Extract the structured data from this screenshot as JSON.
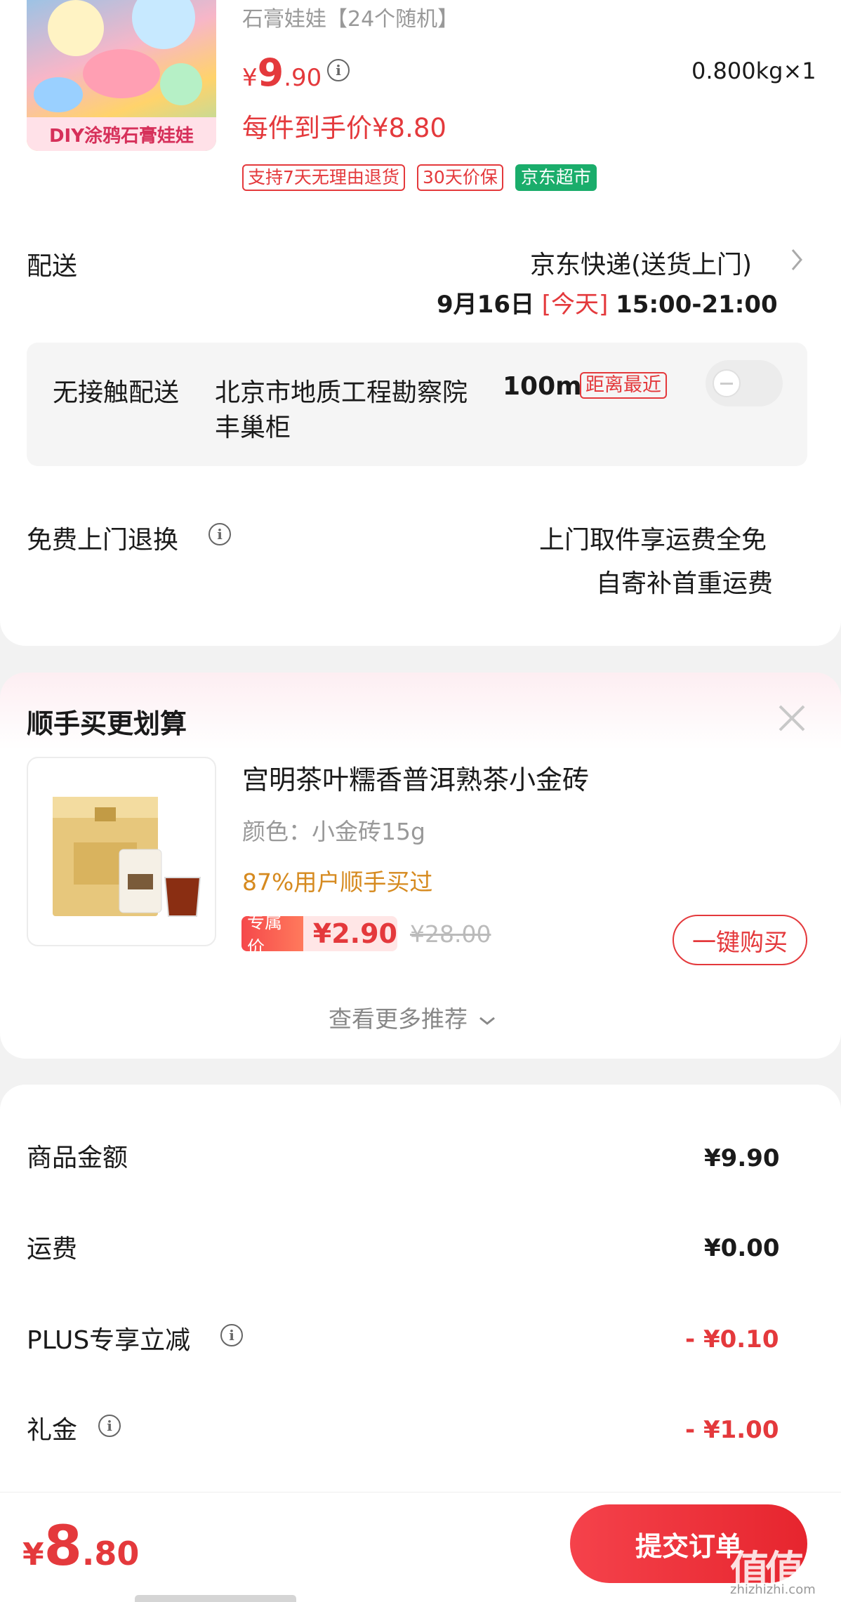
{
  "product": {
    "title_tail": "石膏娃娃【24个随机】",
    "image_banner": "DIY涂鸦石膏娃娃",
    "price_symbol": "¥",
    "price_int": "9",
    "price_dec": ".90",
    "weight_qty": "0.800kg×1",
    "final_price": "每件到手价¥8.80",
    "tags": [
      "支持7天无理由退货",
      "30天价保"
    ],
    "store_tag": "京东超市"
  },
  "delivery": {
    "label": "配送",
    "method": "京东快递(送货上门)",
    "date": "9月16日",
    "today": "[今天]",
    "time": "15:00-21:00"
  },
  "contactless": {
    "label": "无接触配送",
    "location_line1": "北京市地质工程勘察院",
    "distance": "100m",
    "nearest_tag": "距离最近",
    "location_line2": "丰巢柜"
  },
  "returns": {
    "label": "免费上门退换",
    "line1": "上门取件享运费全免",
    "line2": "自寄补首重运费"
  },
  "addon": {
    "title": "顺手买更划算",
    "product_name": "宫明茶叶糯香普洱熟茶小金砖",
    "spec": "颜色：小金砖15g",
    "social_proof": "87%用户顺手买过",
    "price_label": "专属价",
    "price": "¥2.90",
    "original_price": "¥28.00",
    "buy_button": "一键购买",
    "more": "查看更多推荐"
  },
  "summary": {
    "rows": [
      {
        "label": "商品金额",
        "value": "¥9.90",
        "info": false,
        "discount": false
      },
      {
        "label": "运费",
        "value": "¥0.00",
        "info": false,
        "discount": false
      },
      {
        "label": "PLUS专享立减",
        "value": "- ¥0.10",
        "info": true,
        "discount": true
      },
      {
        "label": "礼金",
        "value": "- ¥1.00",
        "info": true,
        "discount": true
      }
    ]
  },
  "footer": {
    "total_symbol": "¥",
    "total_int": "8",
    "total_dec": ".80",
    "submit": "提交订单",
    "watermark": "值值值",
    "watermark_url": "zhizhizhi.com"
  },
  "colors": {
    "accent": "#e4393c",
    "store_green": "#1aad6b",
    "gold": "#d68a1f"
  }
}
